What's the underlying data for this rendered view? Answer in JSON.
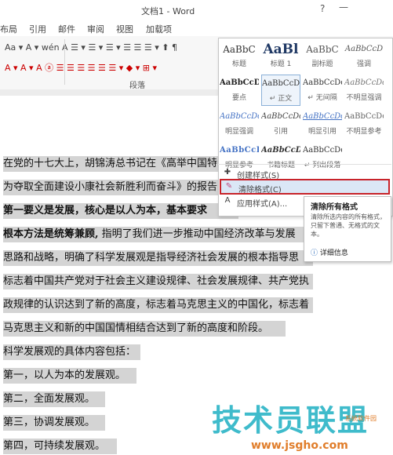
{
  "window": {
    "title": "文档1 - Word",
    "help_icon": "?",
    "minimize_icon": "—"
  },
  "tabs": [
    "布局",
    "引用",
    "邮件",
    "审阅",
    "视图",
    "加载项"
  ],
  "ribbon": {
    "row1": "Aa ▾   A ▾  wén  A   ☰ ▾  ☰ ▾  ☰ ▾   ☰  ☰   ☰ ▾  ⬆  ¶",
    "row2": "A ▾   A ▾  A  ⓐ   ☰  ☰  ☰  ☰  ☰   ☰ ▾   ◆ ▾  ⊞ ▾",
    "group_label": "段落"
  },
  "styles_gallery": [
    {
      "preview": "AaBbC",
      "name": "标题"
    },
    {
      "preview": "AaBl",
      "name": "标题 1"
    },
    {
      "preview": "AaBbC",
      "name": "副标题"
    },
    {
      "preview": "AaBbCcD",
      "name": "强调"
    },
    {
      "preview": "AaBbCcD",
      "name": "要点"
    },
    {
      "preview": "AaBbCcDd",
      "name": "↵ 正文"
    },
    {
      "preview": "AaBbCcDd",
      "name": "↵ 无间隔"
    },
    {
      "preview": "AaBbCcDd",
      "name": "不明显强调"
    },
    {
      "preview": "AaBbCcDd",
      "name": "明显强调"
    },
    {
      "preview": "AaBbCcDd",
      "name": "引用"
    },
    {
      "preview": "AaBbCcDd",
      "name": "明显引用"
    },
    {
      "preview": "AaBbCcDd",
      "name": "不明显参考"
    },
    {
      "preview": "AaBbCcI",
      "name": "明显参考"
    },
    {
      "preview": "AaBbCcDd",
      "name": "书籍标题"
    },
    {
      "preview": "AaBbCcDd",
      "name": "↵ 列出段落"
    }
  ],
  "gallery_commands": {
    "create_style": "创建样式(S)",
    "clear_formatting": "清除格式(C)",
    "apply_styles": "应用样式(A)..."
  },
  "tooltip": {
    "title": "清除所有格式",
    "description": "清除所选内容的所有格式，只留下普通、无格式的文本。",
    "more_info": "详细信息"
  },
  "document_lines": [
    "在党的十七大上，胡锦涛总书记在《高举中国特",
    "为夺取全面建设小康社会新胜利而奋斗》的报告",
    "第一要义是发展，核心是以人为本，基本要求",
    "根本方法是统筹兼顾,",
    " 指明了我们进一步推动中国经济改革与发展",
    "思路和战略，明确了科学发展观是指导经济社会发展的根本指导思",
    "标志着中国共产党对于社会主义建设规律、社会发展规律、共产党执",
    "政规律的认识达到了新的高度，标志着马克思主义的中国化，标志着",
    "马克思主义和新的中国国情相结合达到了新的高度和阶段。",
    "科学发展观的具体内容包括：",
    "第一，以人为本的发展观。",
    "第二，全面发展观。",
    "第三，协调发展观。",
    "第四，可持续发展观。"
  ],
  "watermark": {
    "main": "技术员联盟",
    "url": "www.jsgho.com",
    "small": "系统软件园"
  }
}
